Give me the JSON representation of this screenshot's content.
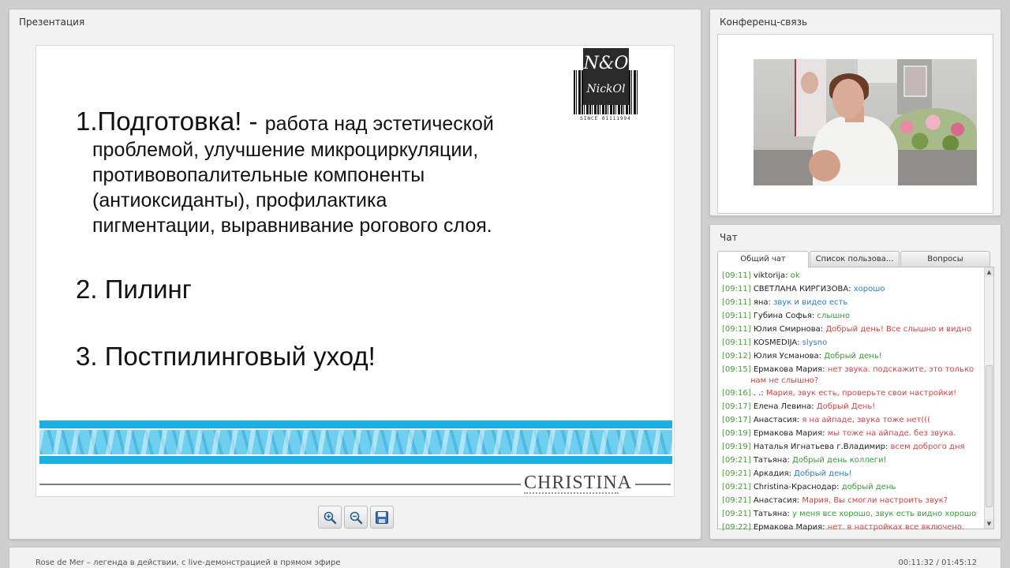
{
  "presentation": {
    "title": "Презентация",
    "slide": {
      "item1_head": "1.Подготовка! - ",
      "item1_tail": "работа над эстетической",
      "item1_lines": [
        "проблемой, улучшение микроциркуляции,",
        "противовопалительные компоненты",
        "(антиоксиданты),  профилактика",
        "пигментации, выравнивание рогового слоя."
      ],
      "item2": "2. Пилинг",
      "item3": "3. Постпилинговый уход!",
      "logo_top": "N&O",
      "logo_bottom": "NickOl",
      "logo_since": "SINCE 01111994",
      "brand": "CHRISTINA"
    },
    "toolbar": {
      "zoom_in_icon": "zoom-in-icon",
      "zoom_out_icon": "zoom-out-icon",
      "save_icon": "save-icon"
    }
  },
  "conference": {
    "title": "Конференц-связь"
  },
  "chat": {
    "title": "Чат",
    "tabs": [
      "Общий чат",
      "Список пользова...",
      "Вопросы"
    ],
    "colors": {
      "timestamp": "#4a9a3c",
      "red": "#d04545",
      "green": "#3a9a3a",
      "blue": "#2e7fc0"
    },
    "messages": [
      {
        "time": "[09:11]",
        "user": "viktorija:",
        "text": "ok",
        "color": "#3a9a3a"
      },
      {
        "time": "[09:11]",
        "user": "СВЕТЛАНА КИРГИЗОВА:",
        "text": "хорошо",
        "color": "#2e7fc0"
      },
      {
        "time": "[09:11]",
        "user": "яна:",
        "text": "звук и видео есть",
        "color": "#2e7fc0"
      },
      {
        "time": "[09:11]",
        "user": "Губина Софья:",
        "text": "слышно",
        "color": "#3a9a3a"
      },
      {
        "time": "[09:11]",
        "user": "Юлия Смирнова:",
        "text": "Добрый день! Все слышно и видно",
        "color": "#d04545"
      },
      {
        "time": "[09:11]",
        "user": "KOSMEDIJA:",
        "text": "slysno",
        "color": "#2e7fc0"
      },
      {
        "time": "[09:12]",
        "user": "Юлия Усманова:",
        "text": "Добрый день!",
        "color": "#3a9a3a"
      },
      {
        "time": "[09:15]",
        "user": "Ермакова Мария:",
        "text": "нет звука. подскажите, это только нам не слышно?",
        "color": "#d04545",
        "wrap": true
      },
      {
        "time": "[09:16]",
        "user": ". .:",
        "text": "Мария, звук есть, проверьте свои настройки!",
        "color": "#d04545"
      },
      {
        "time": "[09:17]",
        "user": "Елена Левина:",
        "text": "Добрый День!",
        "color": "#d04545"
      },
      {
        "time": "[09:17]",
        "user": "Анастасия:",
        "text": "я на айпаде, звука тоже нет(((",
        "color": "#d04545"
      },
      {
        "time": "[09:19]",
        "user": "Ермакова Мария:",
        "text": "мы тоже на айпаде. без звука.",
        "color": "#d04545"
      },
      {
        "time": "[09:19]",
        "user": "Наталья Игнатьева г.Владимир:",
        "text": "всем доброго дня",
        "color": "#d04545"
      },
      {
        "time": "[09:21]",
        "user": "Татьяна:",
        "text": "Добрый день коллеги!",
        "color": "#3a9a3a"
      },
      {
        "time": "[09:21]",
        "user": "Аркадия:",
        "text": "Добрый день!",
        "color": "#2e7fc0"
      },
      {
        "time": "[09:21]",
        "user": "Christina-Краснодар:",
        "text": "добрый день",
        "color": "#3a9a3a"
      },
      {
        "time": "[09:21]",
        "user": "Анастасия:",
        "text": "Мария, Вы смогли настроить звук?",
        "color": "#d04545"
      },
      {
        "time": "[09:21]",
        "user": "Татьяна:",
        "text": "у меня все хорошо, звук есть видно хорошо",
        "color": "#3a9a3a"
      },
      {
        "time": "[09:22]",
        "user": "Ермакова Мария:",
        "text": "нет. в настройках все включено.",
        "color": "#d04545"
      }
    ]
  },
  "statusbar": {
    "title": "Rose de Mer – легенда в действии, с live-демонстрацией в прямом эфире",
    "time": "00:11:32 / 01:45:12"
  }
}
